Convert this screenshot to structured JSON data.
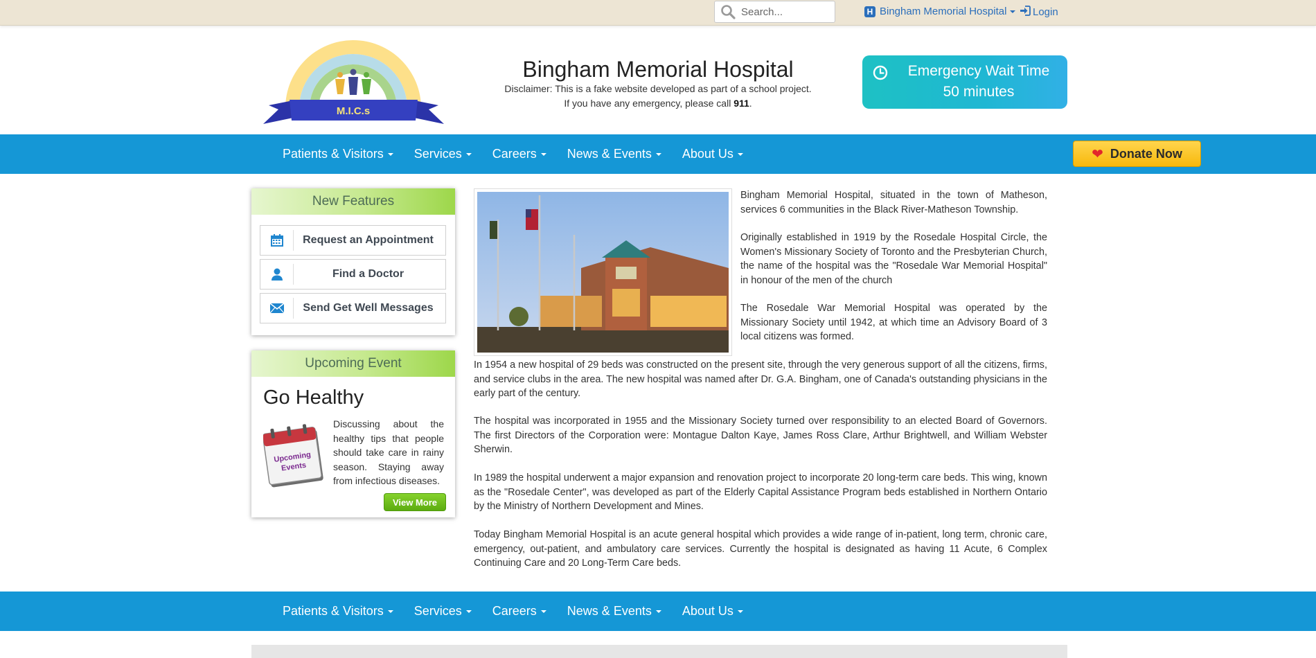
{
  "topbar": {
    "search_placeholder": "Search...",
    "hospital_selector": "Bingham Memorial Hospital",
    "login": "Login"
  },
  "header": {
    "logo_text": "M.I.C.s",
    "title": "Bingham Memorial Hospital",
    "disclaimer_line1": "Disclaimer: This is a fake website developed as part of a school project.",
    "disclaimer_line2_prefix": "If you have any emergency, please call ",
    "emergency_number": "911",
    "disclaimer_line2_suffix": ".",
    "er_title": "Emergency Wait Time",
    "er_time": "50 minutes"
  },
  "nav": {
    "items": [
      "Patients & Visitors",
      "Services",
      "Careers",
      "News & Events",
      "About Us"
    ],
    "donate": "Donate Now"
  },
  "features": {
    "heading": "New Features",
    "items": [
      "Request an Appointment",
      "Find a Doctor",
      "Send Get Well Messages"
    ]
  },
  "event": {
    "heading": "Upcoming Event",
    "title": "Go Healthy",
    "calendar_text": "Upcoming Events",
    "description": "Discussing about the healthy tips that people should take care in rainy season. Staying away from infectious diseases.",
    "button": "View More"
  },
  "content": {
    "paragraphs": [
      "Bingham Memorial Hospital, situated in the town of Matheson, services 6 communities in the Black River-Matheson Township.",
      "Originally established in 1919 by the Rosedale Hospital Circle, the Women's Missionary Society of Toronto and the Presbyterian Church, the name of the hospital was the \"Rosedale War Memorial Hospital\" in honour of the men of the church",
      "The Rosedale War Memorial Hospital was operated by the Missionary Society until 1942, at which time an Advisory Board of 3 local citizens was formed.",
      "In 1954 a new hospital of 29 beds was constructed on the present site, through the very generous support of all the citizens, firms, and service clubs in the area. The new hospital was named after Dr. G.A. Bingham, one of Canada's outstanding physicians in the early part of the century.",
      "The hospital was incorporated in 1955 and the Missionary Society turned over responsibility to an elected Board of Governors. The first Directors of the Corporation were: Montague Dalton Kaye, James Ross Clare, Arthur Brightwell, and William Webster Sherwin.",
      "In 1989 the hospital underwent a major expansion and renovation project to incorporate 20 long-term care beds. This wing, known as the \"Rosedale Center\", was developed as part of the Elderly Capital Assistance Program beds established in Northern Ontario by the Ministry of Northern Development and Mines.",
      "Today Bingham Memorial Hospital is an acute general hospital which provides a wide range of in-patient, long term, chronic care, emergency, out-patient, and ambulatory care services. Currently the hospital is designated as having 11 Acute, 6 Complex Continuing Care and 20 Long-Term Care beds."
    ]
  },
  "colors": {
    "nav_blue": "#1597d6",
    "topbar_beige": "#ede5d4",
    "link_blue": "#2a6ebb",
    "donate_yellow": "#f7b80c",
    "widget_green": "#9dd74a",
    "er_teal": "#1ec1c4"
  },
  "icons": {
    "search": "search-icon",
    "hospital": "hospital-icon",
    "login": "login-icon",
    "clock": "clock-icon",
    "heart": "heart-icon",
    "calendar": "calendar-icon",
    "user": "user-icon",
    "envelope": "envelope-icon"
  }
}
